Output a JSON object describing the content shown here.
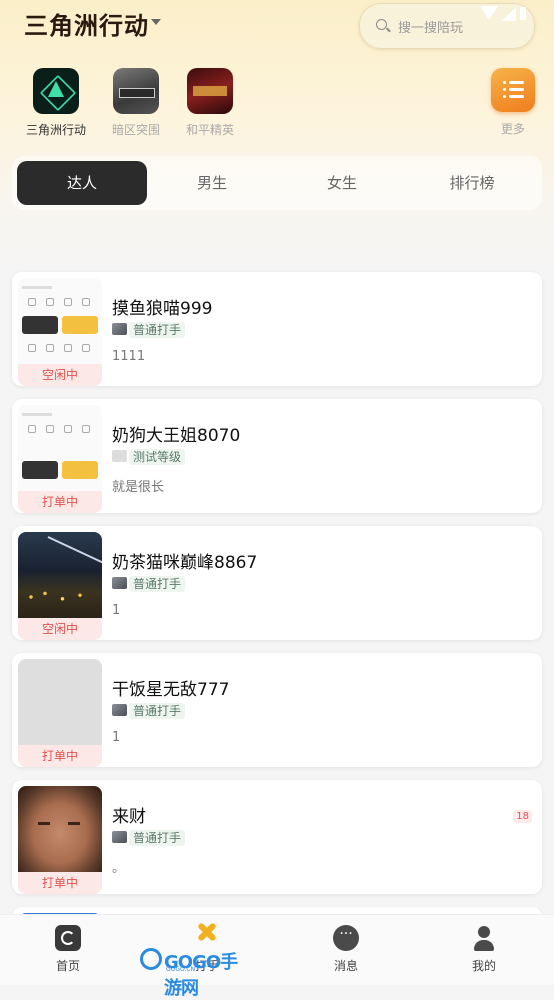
{
  "header": {
    "game_title": "三角洲行动",
    "search_placeholder": "搜一搜陪玩"
  },
  "games": [
    {
      "label": "三角洲行动",
      "icon": "delta-force-icon",
      "active": true
    },
    {
      "label": "暗区突围",
      "icon": "arena-breakout-icon",
      "active": false
    },
    {
      "label": "和平精英",
      "icon": "peace-elite-icon",
      "active": false
    }
  ],
  "more": {
    "label": "更多",
    "icon": "menu-list-icon"
  },
  "tabs": [
    {
      "label": "达人",
      "active": true
    },
    {
      "label": "男生",
      "active": false
    },
    {
      "label": "女生",
      "active": false
    },
    {
      "label": "排行榜",
      "active": false
    }
  ],
  "players": [
    {
      "name": "摸鱼狼喵999",
      "level": "普通打手",
      "bio": "1111",
      "status": "空闲中",
      "thumb": "app-screenshot"
    },
    {
      "name": "奶狗大王姐8070",
      "level": "测试等级",
      "bio": "就是很长",
      "status": "打单中",
      "thumb": "app-screenshot"
    },
    {
      "name": "奶茶猫咪巅峰8867",
      "level": "普通打手",
      "bio": "1",
      "status": "空闲中",
      "thumb": "city-night"
    },
    {
      "name": "干饭星无敌777",
      "level": "普通打手",
      "bio": "1",
      "status": "打单中",
      "thumb": "blank"
    },
    {
      "name": "来财",
      "level": "普通打手",
      "bio": "。",
      "status": "打单中",
      "thumb": "face",
      "age": "18"
    }
  ],
  "bottom_nav": [
    {
      "label": "首页",
      "icon": "home-icon"
    },
    {
      "label": "打手",
      "icon": "crossed-swords-icon"
    },
    {
      "label": "消息",
      "icon": "chat-bubble-icon"
    },
    {
      "label": "我的",
      "icon": "user-icon"
    }
  ],
  "watermark": {
    "text": "GOGO手游网",
    "sub": "GOGO.CN"
  },
  "colors": {
    "accent_dark": "#2b2b2b",
    "status_red": "#e0524f",
    "more_orange": "#f39a30",
    "level_green": "#5a7a6a"
  }
}
